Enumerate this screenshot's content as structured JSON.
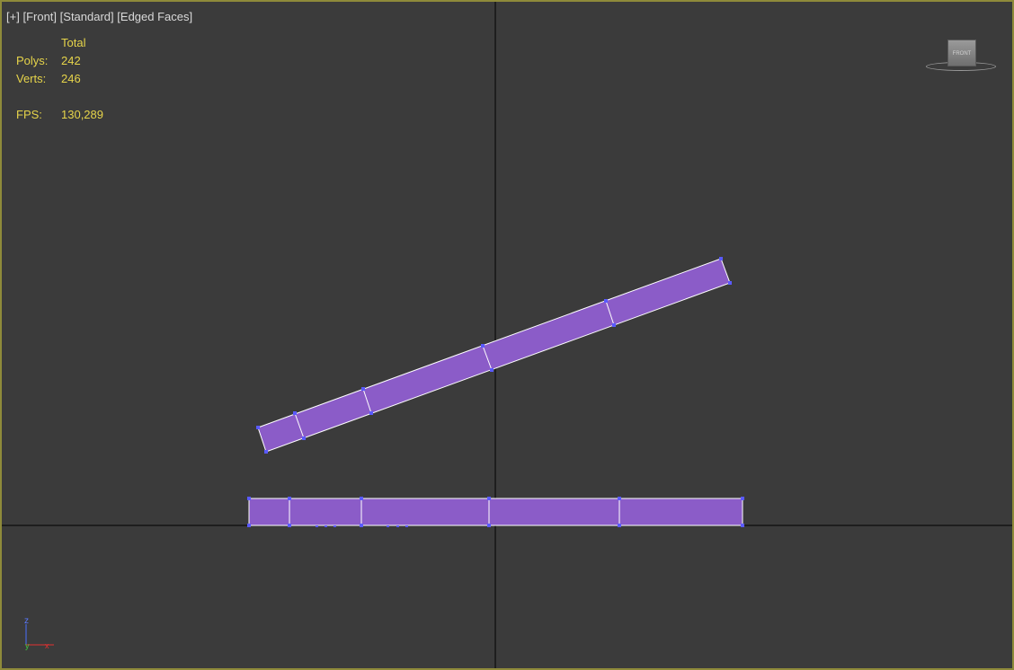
{
  "viewport": {
    "labels": [
      "[+]",
      "[Front]",
      "[Standard]",
      "[Edged Faces]"
    ]
  },
  "stats": {
    "header": "Total",
    "polys_label": "Polys:",
    "polys_value": "242",
    "verts_label": "Verts:",
    "verts_value": "246",
    "fps_label": "FPS:",
    "fps_value": "130,289"
  },
  "viewcube": {
    "face_label": "FRONT"
  },
  "axis_gizmo": {
    "up": "z",
    "left": "y",
    "right": "x"
  },
  "colors": {
    "background": "#3b3b3b",
    "border": "#8e8a3a",
    "object_fill": "#8b5cc8",
    "edge": "#ffffff",
    "vertex": "#5a5aff",
    "stats_text": "#e6d44a",
    "grid_axis": "#000000"
  }
}
